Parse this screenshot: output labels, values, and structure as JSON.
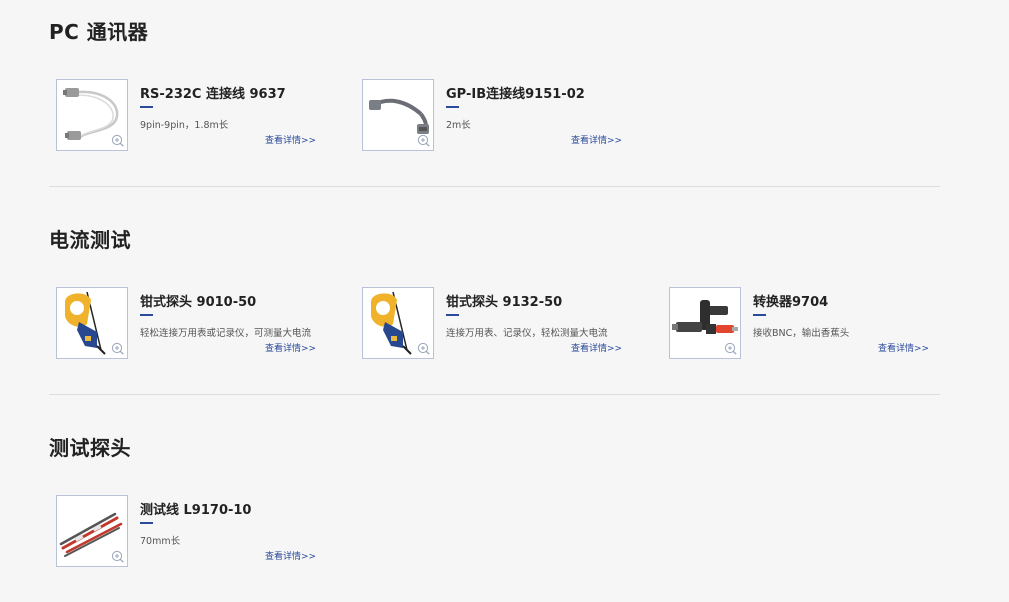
{
  "sections": [
    {
      "title": "PC 通讯器",
      "products": [
        {
          "name": "RS-232C 连接线 9637",
          "desc": "9pin-9pin，1.8m长",
          "more": "查看详情>>",
          "image_icon": "serial-cable-image"
        },
        {
          "name": "GP-IB连接线9151-02",
          "desc": "2m长",
          "more": "查看详情>>",
          "image_icon": "gpib-cable-image"
        }
      ]
    },
    {
      "title": "电流测试",
      "products": [
        {
          "name": "钳式探头 9010-50",
          "desc": "轻松连接万用表或记录仪，可测量大电流",
          "more": "查看详情>>",
          "image_icon": "clamp-probe-image"
        },
        {
          "name": "钳式探头 9132-50",
          "desc": "连接万用表、记录仪，轻松测量大电流",
          "more": "查看详情>>",
          "image_icon": "clamp-probe-image"
        },
        {
          "name": "转换器9704",
          "desc": "接收BNC，输出香蕉头",
          "more": "查看详情>>",
          "image_icon": "bnc-adapter-image"
        }
      ]
    },
    {
      "title": "测试探头",
      "products": [
        {
          "name": "测试线 L9170-10",
          "desc": "70mm长",
          "more": "查看详情>>",
          "image_icon": "test-leads-image"
        }
      ]
    }
  ],
  "colors": {
    "accent": "#2b4a9a",
    "background": "#f6f6f7",
    "thumb_border": "#b9c2d6",
    "divider": "#dedede"
  }
}
